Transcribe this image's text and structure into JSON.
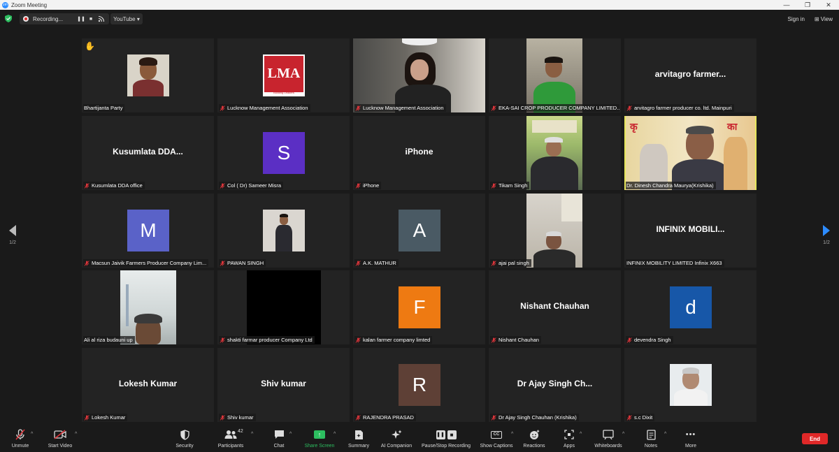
{
  "window": {
    "title": "Zoom Meeting",
    "app_icon": "zm",
    "minimize": "—",
    "maximize": "❐",
    "close": "✕"
  },
  "topbar": {
    "recording_label": "Recording...",
    "stream_label": "YouTube ▾",
    "signin_label": "Sign in",
    "view_label": "View",
    "view_icon": "⊞"
  },
  "pagination": {
    "left": "1/2",
    "right": "1/2"
  },
  "tiles": [
    {
      "name": "Bhartijanta Party"
    },
    {
      "name": "Lucknow Management Association",
      "logo_text": "LMA",
      "logo_sub": "Building Leaders"
    },
    {
      "name": "Lucknow Management Association"
    },
    {
      "name": "EKA-SAI CROP PRODUCER COMPANY LIMITED..."
    },
    {
      "name": "arvitagro farmer producer co. ltd. Mainpuri",
      "center": "arvitagro  farmer..."
    },
    {
      "name": "Kusumlata DDA office",
      "center": "Kusumlata  DDA..."
    },
    {
      "name": "Col ( Dr) Sameer Misra",
      "letter": "S"
    },
    {
      "name": "iPhone",
      "center": "iPhone"
    },
    {
      "name": "Tikam Singh"
    },
    {
      "name": "Dr. Dinesh Chandra Maurya(Krishika)"
    },
    {
      "name": "Macsun Jaivik Farmers Producer Company Lim...",
      "letter": "M"
    },
    {
      "name": "PAWAN SINGH"
    },
    {
      "name": "A.K. MATHUR",
      "letter": "A"
    },
    {
      "name": "ajai pal singh"
    },
    {
      "name": "INFINIX MOBILITY LIMITED Infinix X663",
      "center": "INFINIX  MOBILI..."
    },
    {
      "name": "Ali al riza budauni up"
    },
    {
      "name": "shakti farmar producer Company Ltd"
    },
    {
      "name": "kalan farmer company limted",
      "letter": "F"
    },
    {
      "name": "Nishant Chauhan",
      "center": "Nishant Chauhan"
    },
    {
      "name": "devendra Singh",
      "letter": "d"
    },
    {
      "name": "Lokesh Kumar",
      "center": "Lokesh Kumar"
    },
    {
      "name": "Shiv kumar",
      "center": "Shiv kumar"
    },
    {
      "name": "RAJENDRA PRASAD",
      "letter": "R"
    },
    {
      "name": "Dr Ajay Singh Chauhan (Krishika)",
      "center": "Dr Ajay Singh Ch..."
    },
    {
      "name": "s.c Dixit"
    }
  ],
  "toolbar": {
    "unmute": "Unmute",
    "start_video": "Start Video",
    "security": "Security",
    "participants": "Participants",
    "participants_count": "42",
    "chat": "Chat",
    "share_screen": "Share Screen",
    "summary": "Summary",
    "ai_companion": "AI Companion",
    "pause_recording": "Pause/Stop Recording",
    "show_captions": "Show Captions",
    "captions_icon": "CC",
    "reactions": "Reactions",
    "apps": "Apps",
    "whiteboards": "Whiteboards",
    "notes": "Notes",
    "more": "More",
    "more_icon": "•••",
    "end": "End"
  },
  "colors": {
    "accent": "#2d8cff",
    "active_speaker": "#e6e65b",
    "end": "#e02828",
    "share": "#2dbe60",
    "avatar_S": "#5b2fc4",
    "avatar_M": "#5a62c8",
    "avatar_A": "#4a5a64",
    "avatar_F": "#ee7a12",
    "avatar_d": "#1757a8",
    "avatar_R": "#5e4036"
  }
}
